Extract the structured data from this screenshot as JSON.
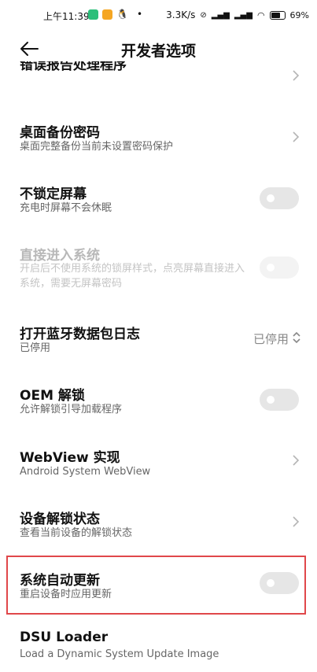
{
  "status_bar": {
    "time": "上午11:39",
    "net_speed": "3.3K/s",
    "battery": "69%"
  },
  "header": {
    "title": "开发者选项"
  },
  "items": [
    {
      "title": "错误报告处理程序",
      "subtitle": ""
    },
    {
      "title": "桌面备份密码",
      "subtitle": "桌面完整备份当前未设置密码保护"
    },
    {
      "title": "不锁定屏幕",
      "subtitle": "充电时屏幕不会休眠"
    },
    {
      "title": "直接进入系统",
      "subtitle": "开启后不使用系统的锁屏样式，点亮屏幕直接进入系统，需要无屏幕密码"
    },
    {
      "title": "打开蓝牙数据包日志",
      "subtitle": "已停用",
      "value": "已停用"
    },
    {
      "title": "OEM 解锁",
      "subtitle": "允许解锁引导加载程序"
    },
    {
      "title": "WebView 实现",
      "subtitle": "Android System WebView"
    },
    {
      "title": "设备解锁状态",
      "subtitle": "查看当前设备的解锁状态"
    },
    {
      "title": "系统自动更新",
      "subtitle": "重启设备时应用更新"
    },
    {
      "title": "DSU Loader",
      "subtitle": "Load a Dynamic System Update Image"
    }
  ],
  "colors": {
    "highlight": "#e0474a",
    "toggle_off": "#e6e6e6"
  }
}
